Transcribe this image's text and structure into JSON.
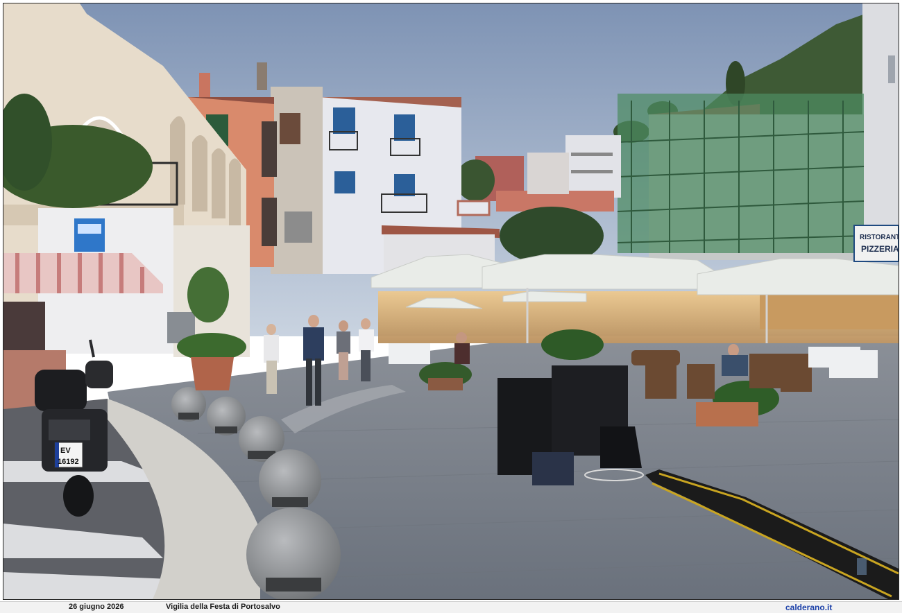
{
  "photo": {
    "sign_restaurant_line1": "RISTORANTE",
    "sign_restaurant_line2": "PIZZERIA",
    "license_plate_line1": "EV",
    "license_plate_line2": "16192",
    "colors": {
      "sky_top": "#7e93b4",
      "sky_bottom": "#c9d3e0",
      "pavement": "#747b86",
      "umbrella": "#e9ece8",
      "scaffold_net": "#4e8c63",
      "building_white": "#e7e8ee",
      "building_salmon": "#d98a6c",
      "building_cream": "#e7dccb"
    }
  },
  "caption": {
    "date": "26 giugno 2026",
    "title": "Vigilia della Festa di Portosalvo",
    "site": "calderano.it"
  }
}
